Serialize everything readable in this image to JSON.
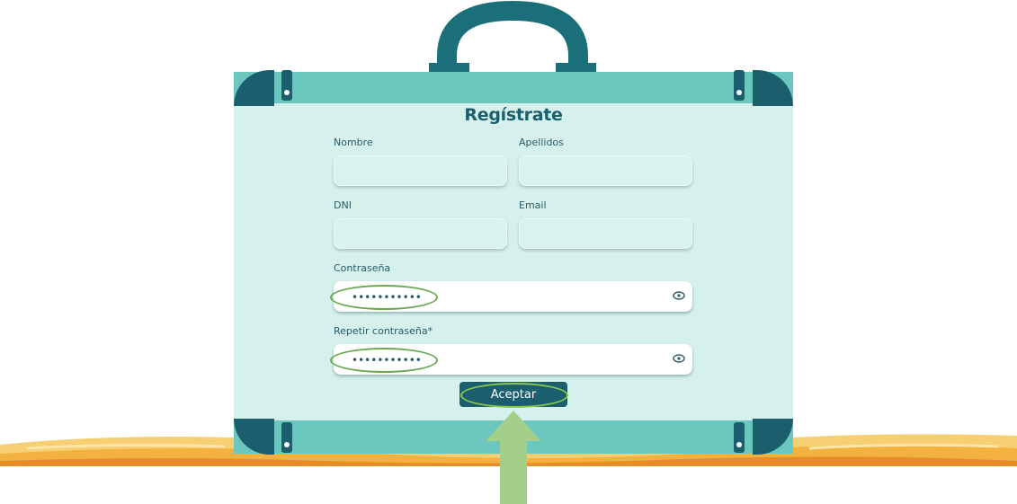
{
  "form": {
    "title": "Regístrate",
    "labels": {
      "nombre": "Nombre",
      "apellidos": "Apellidos",
      "dni": "DNI",
      "email": "Email",
      "password": "Contraseña",
      "repeat_password": "Repetir contraseña*"
    },
    "values": {
      "password": "•••••••••••",
      "repeat_password": "•••••••••••"
    },
    "submit_label": "Aceptar"
  },
  "icons": {
    "password_toggle": "eye-icon",
    "repeat_password_toggle": "eye-icon",
    "pointer": "arrow-up-icon"
  },
  "colors": {
    "brand_dark": "#1b5e6e",
    "suitcase_band": "#6cc7bf",
    "suitcase_body": "#d6f0ec",
    "highlight": "#6aa84f",
    "arrow": "#a3cf8b",
    "sand": "#f3b13f"
  }
}
